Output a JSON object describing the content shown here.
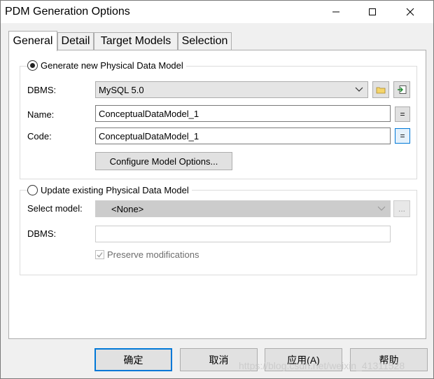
{
  "window": {
    "title": "PDM Generation Options"
  },
  "tabs": [
    {
      "label": "General"
    },
    {
      "label": "Detail"
    },
    {
      "label": "Target Models"
    },
    {
      "label": "Selection"
    }
  ],
  "generate_new": {
    "label": "Generate new Physical Data Model",
    "checked": true,
    "dbms_label": "DBMS:",
    "dbms_value": "MySQL 5.0",
    "name_label": "Name:",
    "name_value": "ConceptualDataModel_1",
    "code_label": "Code:",
    "code_value": "ConceptualDataModel_1",
    "equals": "=",
    "configure_button": "Configure Model Options..."
  },
  "update_existing": {
    "label": "Update existing Physical Data Model",
    "checked": false,
    "select_model_label": "Select model:",
    "select_model_value": "<None>",
    "browse_label": "...",
    "dbms_label": "DBMS:",
    "dbms_value": "",
    "preserve_label": "Preserve modifications",
    "preserve_checked": true
  },
  "footer": {
    "ok": "确定",
    "cancel": "取消",
    "apply": "应用(A)",
    "help": "帮助"
  },
  "watermark": "https://blog.csdn.net/weixin_41311528",
  "colors": {
    "focus": "#0078d7",
    "face": "#f0f0f0"
  }
}
